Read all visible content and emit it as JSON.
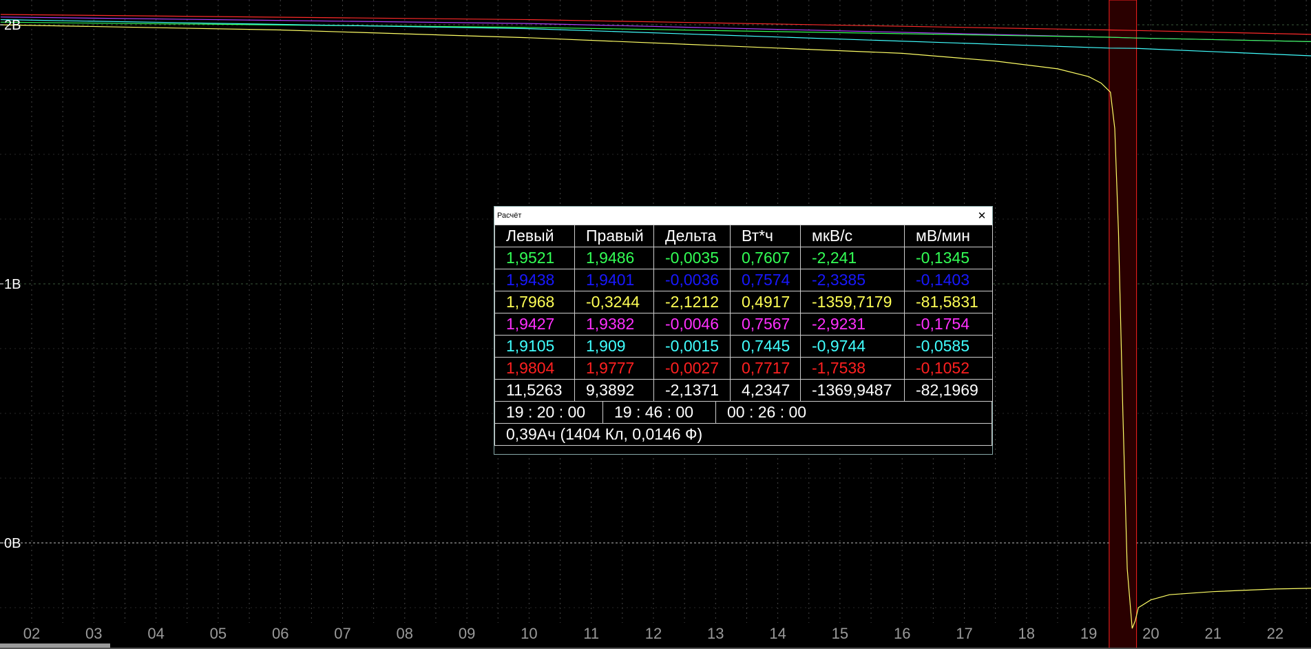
{
  "chart_data": {
    "type": "line",
    "x_ticks": [
      "02",
      "03",
      "04",
      "05",
      "06",
      "07",
      "08",
      "09",
      "10",
      "11",
      "12",
      "13",
      "14",
      "15",
      "16",
      "17",
      "18",
      "19",
      "20",
      "21",
      "22"
    ],
    "xlim": [
      1.5,
      22.6
    ],
    "y_ticks": [
      {
        "label": "2В",
        "value": 2
      },
      {
        "label": "1В",
        "value": 1
      },
      {
        "label": "0В",
        "value": 0
      }
    ],
    "ylim": [
      -0.4,
      2.1
    ],
    "grid": true,
    "highlight_range": [
      19.33,
      19.77
    ],
    "series": [
      {
        "color": "#ff2a2a",
        "points": [
          [
            1.5,
            2.04
          ],
          [
            10,
            2.02
          ],
          [
            19.33,
            1.98
          ],
          [
            19.77,
            1.978
          ],
          [
            22.6,
            1.963
          ]
        ]
      },
      {
        "color": "#b040ff",
        "points": [
          [
            1.5,
            2.03
          ],
          [
            10,
            2.005
          ],
          [
            19.33,
            1.952
          ],
          [
            19.77,
            1.949
          ],
          [
            22.6,
            1.935
          ]
        ]
      },
      {
        "color": "#33ff55",
        "points": [
          [
            1.5,
            2.01
          ],
          [
            10,
            1.99
          ],
          [
            19.33,
            1.952
          ],
          [
            19.77,
            1.949
          ],
          [
            22.6,
            1.935
          ]
        ]
      },
      {
        "color": "#40ffff",
        "points": [
          [
            1.5,
            2.02
          ],
          [
            10,
            1.985
          ],
          [
            19.33,
            1.91
          ],
          [
            19.77,
            1.909
          ],
          [
            22.6,
            1.88
          ]
        ]
      },
      {
        "color": "#ffff66",
        "points": [
          [
            1.5,
            2.0
          ],
          [
            6,
            1.98
          ],
          [
            10,
            1.95
          ],
          [
            14,
            1.91
          ],
          [
            16,
            1.89
          ],
          [
            17.5,
            1.86
          ],
          [
            18.5,
            1.83
          ],
          [
            19.0,
            1.8
          ],
          [
            19.2,
            1.775
          ],
          [
            19.35,
            1.74
          ],
          [
            19.42,
            1.6
          ],
          [
            19.48,
            1.2
          ],
          [
            19.55,
            0.5
          ],
          [
            19.62,
            -0.1
          ],
          [
            19.7,
            -0.33
          ],
          [
            19.75,
            -0.3
          ],
          [
            19.8,
            -0.25
          ],
          [
            20.0,
            -0.22
          ],
          [
            20.3,
            -0.2
          ],
          [
            21,
            -0.188
          ],
          [
            22,
            -0.178
          ],
          [
            22.6,
            -0.175
          ]
        ]
      }
    ]
  },
  "popup": {
    "title": "Расчёт",
    "headers": [
      "Левый",
      "Правый",
      "Дельта",
      "Вт*ч",
      "мкВ/с",
      "мВ/мин"
    ],
    "rows": [
      {
        "color": "#33ff55",
        "cells": [
          "1,9521",
          "1,9486",
          "-0,0035",
          "0,7607",
          "-2,241",
          "-0,1345"
        ]
      },
      {
        "color": "#1818ff",
        "cells": [
          "1,9438",
          "1,9401",
          "-0,0036",
          "0,7574",
          "-2,3385",
          "-0,1403"
        ]
      },
      {
        "color": "#ffff55",
        "cells": [
          "1,7968",
          "-0,3244",
          "-2,1212",
          "0,4917",
          "-1359,7179",
          "-81,5831"
        ]
      },
      {
        "color": "#ff30ff",
        "cells": [
          "1,9427",
          "1,9382",
          "-0,0046",
          "0,7567",
          "-2,9231",
          "-0,1754"
        ]
      },
      {
        "color": "#40ffff",
        "cells": [
          "1,9105",
          "1,909",
          "-0,0015",
          "0,7445",
          "-0,9744",
          "-0,0585"
        ]
      },
      {
        "color": "#ff2020",
        "cells": [
          "1,9804",
          "1,9777",
          "-0,0027",
          "0,7717",
          "-1,7538",
          "-0,1052"
        ]
      },
      {
        "color": "#ffffff",
        "cells": [
          "11,5263",
          "9,3892",
          "-2,1371",
          "4,2347",
          "-1369,9487",
          "-82,1969"
        ]
      }
    ],
    "times": [
      "19 : 20 : 00",
      "19 : 46 : 00",
      "00 : 26 : 00"
    ],
    "charge": "0,39Ач (1404 Кл, 0,0146 Ф)"
  }
}
